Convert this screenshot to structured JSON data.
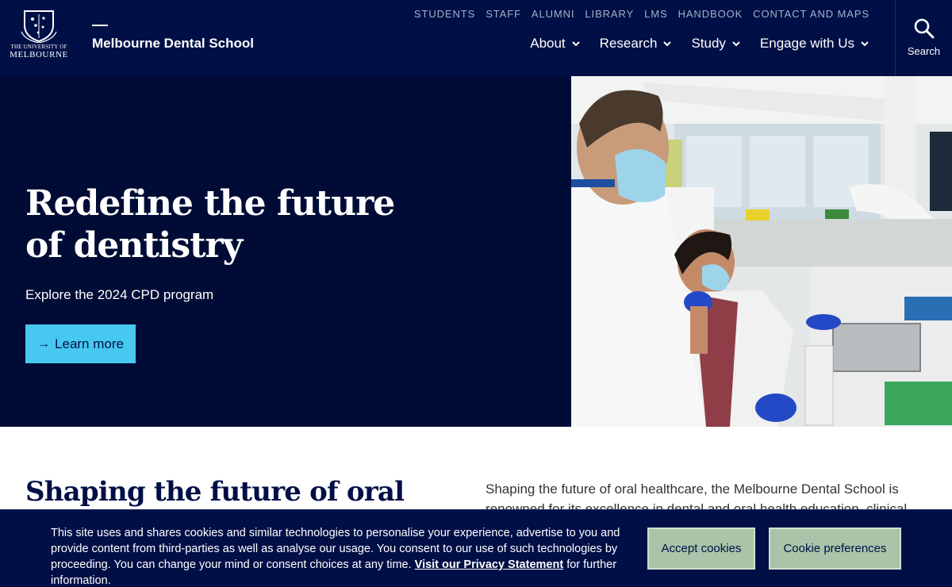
{
  "header": {
    "logo_line1": "THE UNIVERSITY OF",
    "logo_line2": "MELBOURNE",
    "site_name": "Melbourne Dental School",
    "utility_links": [
      "STUDENTS",
      "STAFF",
      "ALUMNI",
      "LIBRARY",
      "LMS",
      "HANDBOOK",
      "CONTACT AND MAPS"
    ],
    "nav_items": [
      "About",
      "Research",
      "Study",
      "Engage with Us"
    ],
    "search_label": "Search"
  },
  "hero": {
    "title": "Redefine the future of dentistry",
    "subtitle": "Explore the 2024 CPD program",
    "button_label": "Learn more"
  },
  "intro": {
    "title": "Shaping the future of oral healthcare",
    "text": "Shaping the future of oral healthcare, the Melbourne Dental School is renowned for its excellence in dental and oral health education, clinical"
  },
  "cookie": {
    "text_before": "This site uses and shares cookies and similar technologies to personalise your experience, advertise to you and provide content from third-parties as well as analyse our usage. You consent to our use of such technologies by proceeding. You can change your mind or consent choices at any time.",
    "link_text": "Visit our Privacy Statement",
    "text_after": " for further information.",
    "accept_label": "Accept cookies",
    "prefs_label": "Cookie preferences"
  },
  "colors": {
    "navy": "#000f46",
    "hero_bg": "#000c35",
    "accent_blue": "#46c8f0",
    "cookie_button": "#a9c4a8"
  }
}
